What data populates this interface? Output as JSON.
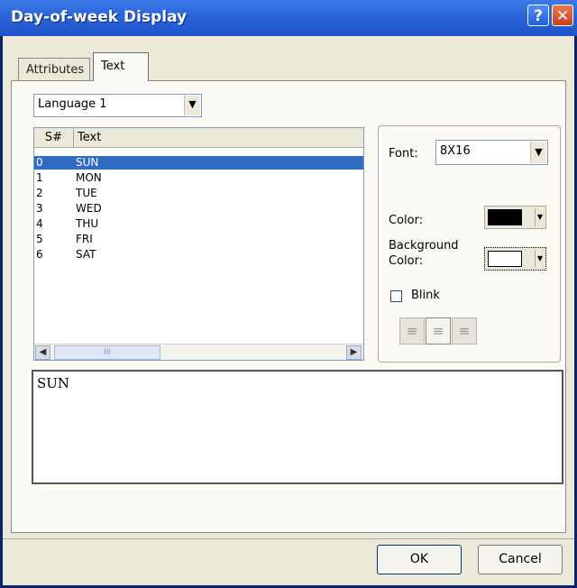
{
  "window": {
    "title": "Day-of-week Display",
    "help_glyph": "?",
    "close_glyph": "✕"
  },
  "tabs": [
    {
      "label": "Attributes",
      "active": false
    },
    {
      "label": "Text",
      "active": true
    }
  ],
  "language_select": {
    "value": "Language 1"
  },
  "text_list": {
    "columns": [
      "S#",
      "Text"
    ],
    "rows": [
      {
        "num": "0",
        "text": "SUN",
        "selected": true
      },
      {
        "num": "1",
        "text": "MON",
        "selected": false
      },
      {
        "num": "2",
        "text": "TUE",
        "selected": false
      },
      {
        "num": "3",
        "text": "WED",
        "selected": false
      },
      {
        "num": "4",
        "text": "THU",
        "selected": false
      },
      {
        "num": "5",
        "text": "FRI",
        "selected": false
      },
      {
        "num": "6",
        "text": "SAT",
        "selected": false
      }
    ]
  },
  "properties": {
    "font_label": "Font:",
    "font_value": "8X16",
    "color_label": "Color:",
    "color_value": "#000000",
    "background_label_line1": "Background",
    "background_label_line2": "Color:",
    "background_value": "#ffffff",
    "blink_label": "Blink",
    "blink_checked": false
  },
  "alignment": {
    "options": [
      "align-left",
      "align-center",
      "align-right"
    ],
    "selected": "align-center"
  },
  "preview": {
    "text": "SUN"
  },
  "buttons": {
    "ok": "OK",
    "cancel": "Cancel"
  },
  "colors": {
    "accent": "#316ac5",
    "titlebar": "#2a64d8",
    "dialog_bg": "#ece9d8"
  }
}
